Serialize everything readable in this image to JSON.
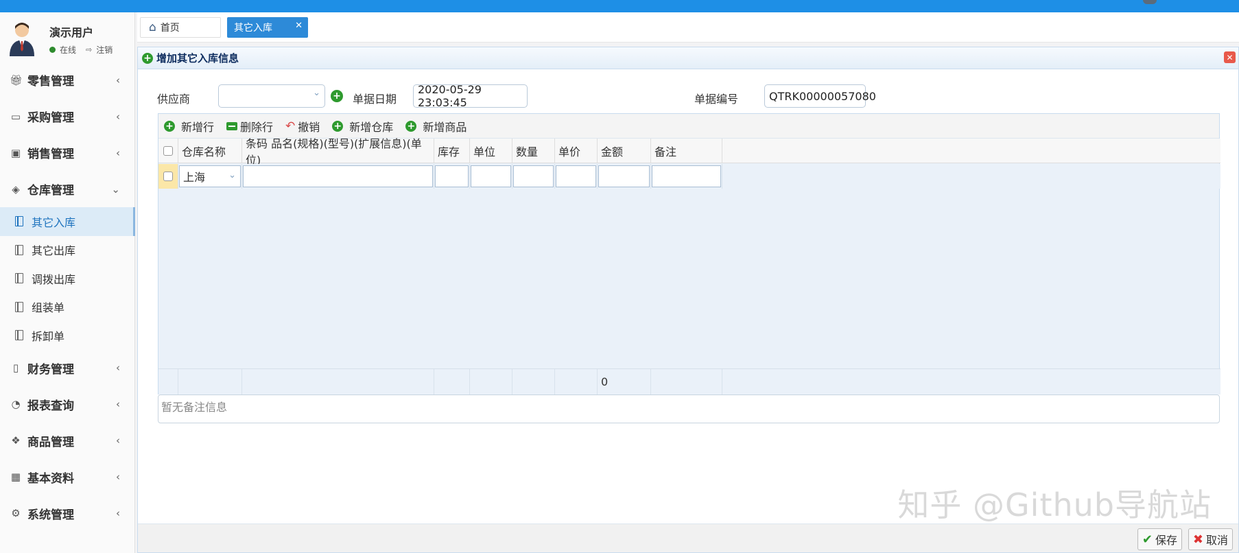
{
  "user": {
    "name": "演示用户",
    "status": "在线",
    "logout": "注销"
  },
  "menu": {
    "retail": "零售管理",
    "purchase": "采购管理",
    "sales": "销售管理",
    "warehouse": "仓库管理",
    "warehouse_items": [
      "其它入库",
      "其它出库",
      "调拨出库",
      "组装单",
      "拆卸单"
    ],
    "finance": "财务管理",
    "reports": "报表查询",
    "products": "商品管理",
    "basic": "基本资料",
    "system": "系统管理"
  },
  "tabs": {
    "home": "首页",
    "active": "其它入库"
  },
  "panel": {
    "title": "增加其它入库信息"
  },
  "form": {
    "supplier_label": "供应商",
    "supplier_value": "",
    "date_label": "单据日期",
    "date_value": "2020-05-29 23:03:45",
    "number_label": "单据编号",
    "number_value": "QTRK00000057080"
  },
  "toolbar": {
    "add_row": "新增行",
    "delete_row": "删除行",
    "undo": "撤销",
    "add_warehouse": "新增仓库",
    "add_product": "新增商品"
  },
  "grid": {
    "columns": [
      "仓库名称",
      "条码 品名(规格)(型号)(扩展信息)(单位)",
      "库存",
      "单位",
      "数量",
      "单价",
      "金额",
      "备注"
    ],
    "row": {
      "warehouse": "上海"
    },
    "footer_amount": "0"
  },
  "remark_placeholder": "暂无备注信息",
  "buttons": {
    "save": "保存",
    "cancel": "取消"
  },
  "watermark": "知乎 @Github导航站",
  "colors": {
    "topbar": "#1e8fe6",
    "tab_active": "#2d8ad8",
    "add_icon": "#2e9a2e"
  }
}
